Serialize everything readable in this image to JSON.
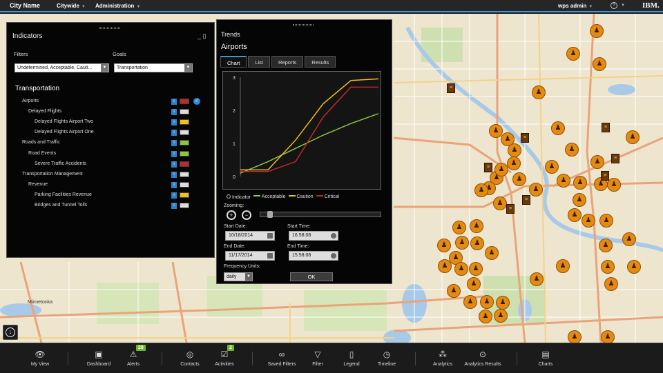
{
  "topbar": {
    "city": "City Name",
    "menu1": "Citywide",
    "menu2": "Administration",
    "user": "wps admin",
    "help": "?",
    "brand": "IBM."
  },
  "indicators": {
    "title": "Indicators",
    "filters_label": "Filters",
    "goals_label": "Goals",
    "filter_value": "Undetermined, Acceptable, Cauti...",
    "goal_value": "Transportation",
    "section": "Transportation",
    "rows": [
      {
        "label": "Airports",
        "indent": 0,
        "status": "#c0282d",
        "checked": true
      },
      {
        "label": "Delayed Flights",
        "indent": 1,
        "status": "#dddddd"
      },
      {
        "label": "Delayed Flights Airport Two",
        "indent": 2,
        "status": "#f2c01d"
      },
      {
        "label": "Delayed Flights Airport One",
        "indent": 2,
        "status": "#dddddd"
      },
      {
        "label": "Roads and Traffic",
        "indent": 0,
        "status": "#8cc63f"
      },
      {
        "label": "Road Events",
        "indent": 1,
        "status": "#8cc63f"
      },
      {
        "label": "Severe Traffic Accidents",
        "indent": 2,
        "status": "#c0282d"
      },
      {
        "label": "Transportation Management",
        "indent": 0,
        "status": "#dddddd"
      },
      {
        "label": "Revenue",
        "indent": 1,
        "status": "#dddddd"
      },
      {
        "label": "Parking Facilities Revenue",
        "indent": 2,
        "status": "#f2c01d"
      },
      {
        "label": "Bridges and Tunnel Tolls",
        "indent": 2,
        "status": "#dddddd"
      }
    ]
  },
  "trends": {
    "title": "Trends",
    "subtitle": "Airports",
    "tabs": [
      "Chart",
      "List",
      "Reports",
      "Results"
    ],
    "zooming_label": "Zooming:",
    "start_date_label": "Start Date:",
    "start_date": "10/18/2014",
    "start_time_label": "Start Time:",
    "start_time": "16:58:08",
    "end_date_label": "End Date:",
    "end_date": "11/17/2014",
    "end_time_label": "End Time:",
    "end_time": "15:58:08",
    "freq_label": "Frequency Units:",
    "freq_value": "daily",
    "ok": "OK"
  },
  "chart_data": {
    "type": "line",
    "ylim": [
      0,
      3
    ],
    "yticks": [
      "0",
      "1",
      "2",
      "3"
    ],
    "x": [
      0,
      1,
      2,
      3,
      4,
      5
    ],
    "series": [
      {
        "name": "Indicator",
        "color": "#dddddd",
        "values": []
      },
      {
        "name": "Acceptable",
        "color": "#8cc63f",
        "values": [
          0.1,
          0.45,
          0.85,
          1.25,
          1.6,
          1.9
        ]
      },
      {
        "name": "Caution",
        "color": "#f2c01d",
        "values": [
          0.2,
          0.2,
          1.1,
          2.2,
          2.9,
          2.95
        ]
      },
      {
        "name": "Critical",
        "color": "#c0282d",
        "values": [
          0.15,
          0.15,
          0.45,
          1.8,
          2.7,
          2.7
        ]
      }
    ]
  },
  "toolbar": [
    {
      "label": "My View",
      "icon": "👁",
      "name": "my-view"
    },
    {
      "label": "Dashboard",
      "icon": "▣",
      "name": "dashboard"
    },
    {
      "label": "Alerts",
      "icon": "⚠",
      "name": "alerts",
      "badge": "28"
    },
    {
      "label": "Contacts",
      "icon": "◎",
      "name": "contacts"
    },
    {
      "label": "Activities",
      "icon": "☑",
      "name": "activities",
      "badge": "2"
    },
    {
      "label": "Saved Filters",
      "icon": "∞",
      "name": "saved-filters"
    },
    {
      "label": "Filter",
      "icon": "▽",
      "name": "filter"
    },
    {
      "label": "Legend",
      "icon": "▯",
      "name": "legend"
    },
    {
      "label": "Timeline",
      "icon": "◷",
      "name": "timeline"
    },
    {
      "label": "Analytics",
      "icon": "⁂",
      "name": "analytics"
    },
    {
      "label": "Analytics Results",
      "icon": "⊙",
      "name": "analytics-results"
    },
    {
      "label": "Charts",
      "icon": "▤",
      "name": "charts"
    }
  ],
  "map_labels": [
    "Minnetonka"
  ]
}
